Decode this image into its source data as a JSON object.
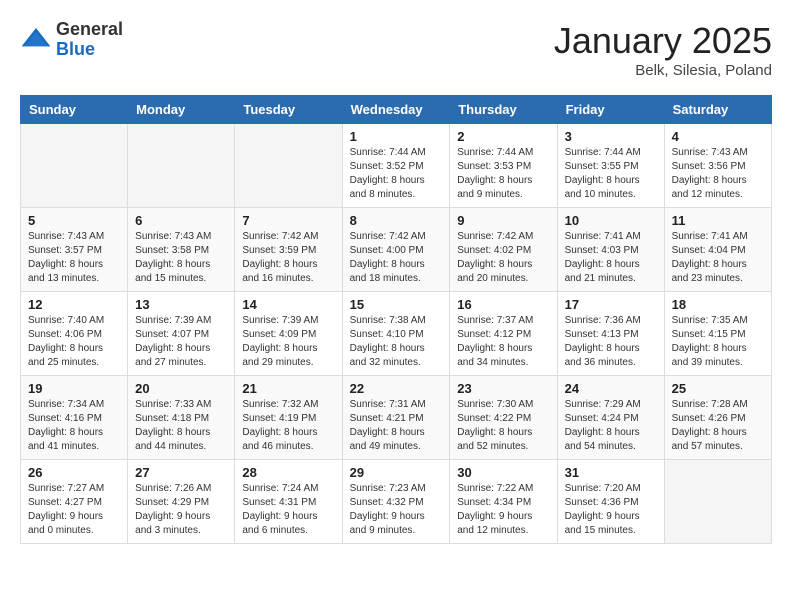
{
  "logo": {
    "general": "General",
    "blue": "Blue"
  },
  "title": "January 2025",
  "location": "Belk, Silesia, Poland",
  "days_header": [
    "Sunday",
    "Monday",
    "Tuesday",
    "Wednesday",
    "Thursday",
    "Friday",
    "Saturday"
  ],
  "weeks": [
    [
      {
        "day": "",
        "info": ""
      },
      {
        "day": "",
        "info": ""
      },
      {
        "day": "",
        "info": ""
      },
      {
        "day": "1",
        "info": "Sunrise: 7:44 AM\nSunset: 3:52 PM\nDaylight: 8 hours and 8 minutes."
      },
      {
        "day": "2",
        "info": "Sunrise: 7:44 AM\nSunset: 3:53 PM\nDaylight: 8 hours and 9 minutes."
      },
      {
        "day": "3",
        "info": "Sunrise: 7:44 AM\nSunset: 3:55 PM\nDaylight: 8 hours and 10 minutes."
      },
      {
        "day": "4",
        "info": "Sunrise: 7:43 AM\nSunset: 3:56 PM\nDaylight: 8 hours and 12 minutes."
      }
    ],
    [
      {
        "day": "5",
        "info": "Sunrise: 7:43 AM\nSunset: 3:57 PM\nDaylight: 8 hours and 13 minutes."
      },
      {
        "day": "6",
        "info": "Sunrise: 7:43 AM\nSunset: 3:58 PM\nDaylight: 8 hours and 15 minutes."
      },
      {
        "day": "7",
        "info": "Sunrise: 7:42 AM\nSunset: 3:59 PM\nDaylight: 8 hours and 16 minutes."
      },
      {
        "day": "8",
        "info": "Sunrise: 7:42 AM\nSunset: 4:00 PM\nDaylight: 8 hours and 18 minutes."
      },
      {
        "day": "9",
        "info": "Sunrise: 7:42 AM\nSunset: 4:02 PM\nDaylight: 8 hours and 20 minutes."
      },
      {
        "day": "10",
        "info": "Sunrise: 7:41 AM\nSunset: 4:03 PM\nDaylight: 8 hours and 21 minutes."
      },
      {
        "day": "11",
        "info": "Sunrise: 7:41 AM\nSunset: 4:04 PM\nDaylight: 8 hours and 23 minutes."
      }
    ],
    [
      {
        "day": "12",
        "info": "Sunrise: 7:40 AM\nSunset: 4:06 PM\nDaylight: 8 hours and 25 minutes."
      },
      {
        "day": "13",
        "info": "Sunrise: 7:39 AM\nSunset: 4:07 PM\nDaylight: 8 hours and 27 minutes."
      },
      {
        "day": "14",
        "info": "Sunrise: 7:39 AM\nSunset: 4:09 PM\nDaylight: 8 hours and 29 minutes."
      },
      {
        "day": "15",
        "info": "Sunrise: 7:38 AM\nSunset: 4:10 PM\nDaylight: 8 hours and 32 minutes."
      },
      {
        "day": "16",
        "info": "Sunrise: 7:37 AM\nSunset: 4:12 PM\nDaylight: 8 hours and 34 minutes."
      },
      {
        "day": "17",
        "info": "Sunrise: 7:36 AM\nSunset: 4:13 PM\nDaylight: 8 hours and 36 minutes."
      },
      {
        "day": "18",
        "info": "Sunrise: 7:35 AM\nSunset: 4:15 PM\nDaylight: 8 hours and 39 minutes."
      }
    ],
    [
      {
        "day": "19",
        "info": "Sunrise: 7:34 AM\nSunset: 4:16 PM\nDaylight: 8 hours and 41 minutes."
      },
      {
        "day": "20",
        "info": "Sunrise: 7:33 AM\nSunset: 4:18 PM\nDaylight: 8 hours and 44 minutes."
      },
      {
        "day": "21",
        "info": "Sunrise: 7:32 AM\nSunset: 4:19 PM\nDaylight: 8 hours and 46 minutes."
      },
      {
        "day": "22",
        "info": "Sunrise: 7:31 AM\nSunset: 4:21 PM\nDaylight: 8 hours and 49 minutes."
      },
      {
        "day": "23",
        "info": "Sunrise: 7:30 AM\nSunset: 4:22 PM\nDaylight: 8 hours and 52 minutes."
      },
      {
        "day": "24",
        "info": "Sunrise: 7:29 AM\nSunset: 4:24 PM\nDaylight: 8 hours and 54 minutes."
      },
      {
        "day": "25",
        "info": "Sunrise: 7:28 AM\nSunset: 4:26 PM\nDaylight: 8 hours and 57 minutes."
      }
    ],
    [
      {
        "day": "26",
        "info": "Sunrise: 7:27 AM\nSunset: 4:27 PM\nDaylight: 9 hours and 0 minutes."
      },
      {
        "day": "27",
        "info": "Sunrise: 7:26 AM\nSunset: 4:29 PM\nDaylight: 9 hours and 3 minutes."
      },
      {
        "day": "28",
        "info": "Sunrise: 7:24 AM\nSunset: 4:31 PM\nDaylight: 9 hours and 6 minutes."
      },
      {
        "day": "29",
        "info": "Sunrise: 7:23 AM\nSunset: 4:32 PM\nDaylight: 9 hours and 9 minutes."
      },
      {
        "day": "30",
        "info": "Sunrise: 7:22 AM\nSunset: 4:34 PM\nDaylight: 9 hours and 12 minutes."
      },
      {
        "day": "31",
        "info": "Sunrise: 7:20 AM\nSunset: 4:36 PM\nDaylight: 9 hours and 15 minutes."
      },
      {
        "day": "",
        "info": ""
      }
    ]
  ]
}
